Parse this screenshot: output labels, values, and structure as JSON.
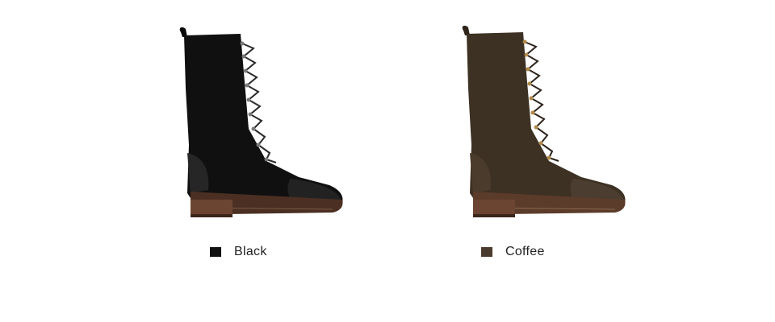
{
  "variants": [
    {
      "label": "Black",
      "swatch_color": "#111111",
      "boot_colors": {
        "upper": "#101010",
        "toe": "#1e1e1e",
        "sole": "#5a3a2a",
        "heel": "#6b4531",
        "eyelet": "#8a8a8a",
        "lace": "#2a2a2a"
      }
    },
    {
      "label": "Coffee",
      "swatch_color": "#4a3a2e",
      "boot_colors": {
        "upper": "#3d3124",
        "toe": "#4b3d30",
        "sole": "#5b3b29",
        "heel": "#6b4531",
        "eyelet": "#b08a4a",
        "lace": "#2d241b"
      }
    }
  ]
}
